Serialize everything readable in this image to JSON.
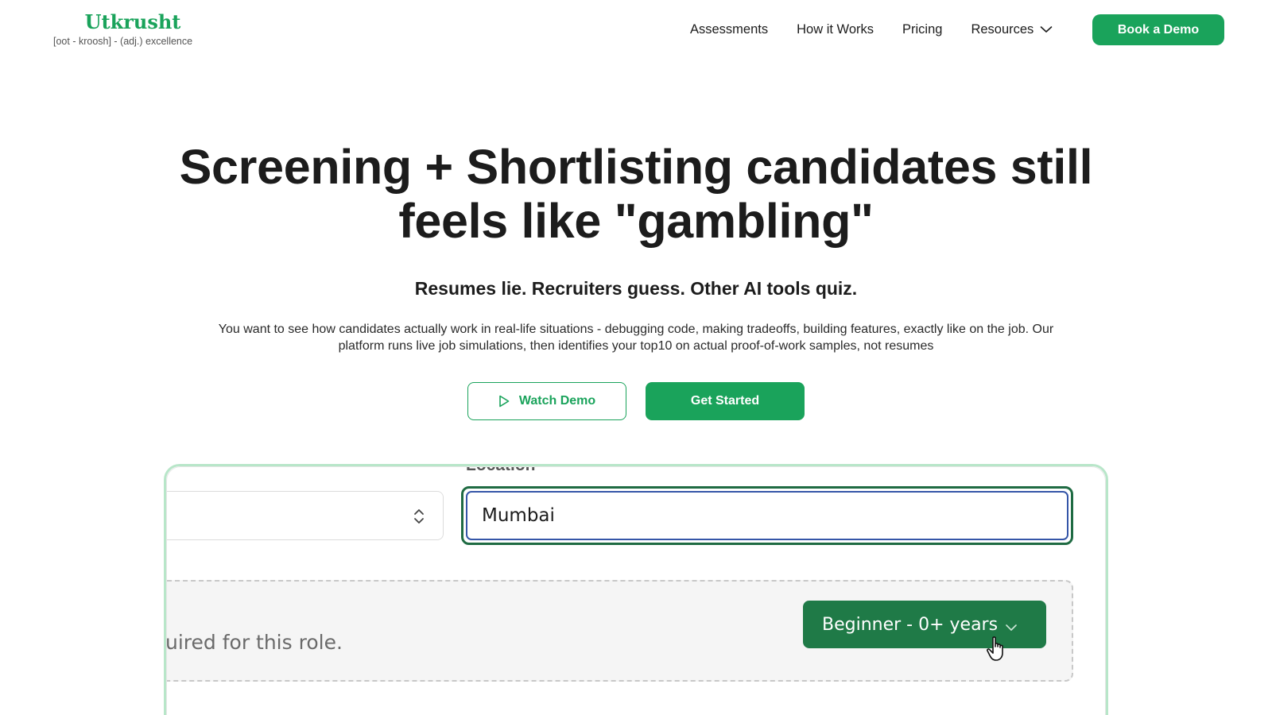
{
  "brand": {
    "name": "Utkrusht",
    "tagline": "[oot - kroosh] - (adj.) excellence",
    "accent_color": "#1aa35b"
  },
  "nav": {
    "items": [
      {
        "label": "Assessments"
      },
      {
        "label": "How it Works"
      },
      {
        "label": "Pricing"
      },
      {
        "label": "Resources",
        "icon": "chevron-down-icon"
      }
    ],
    "cta_label": "Book a Demo"
  },
  "hero": {
    "title_line1": "Screening + Shortlisting candidates still",
    "title_line2": "feels like \"gambling\"",
    "subtitle": "Resumes lie. Recruiters guess. Other AI tools quiz.",
    "description_line1": "You want to see how candidates actually work in real-life situations - debugging code, making tradeoffs, building features, exactly like on the job. Our",
    "description_line2": "platform runs live job simulations, then identifies your top10 on actual proof-of-work samples, not resumes",
    "watch_demo_label": "Watch Demo",
    "get_started_label": "Get Started"
  },
  "demo": {
    "location_label": "Location",
    "location_value": "Mumbai",
    "requirement_text": "uired for this role.",
    "experience_level": "Beginner - 0+ years"
  }
}
